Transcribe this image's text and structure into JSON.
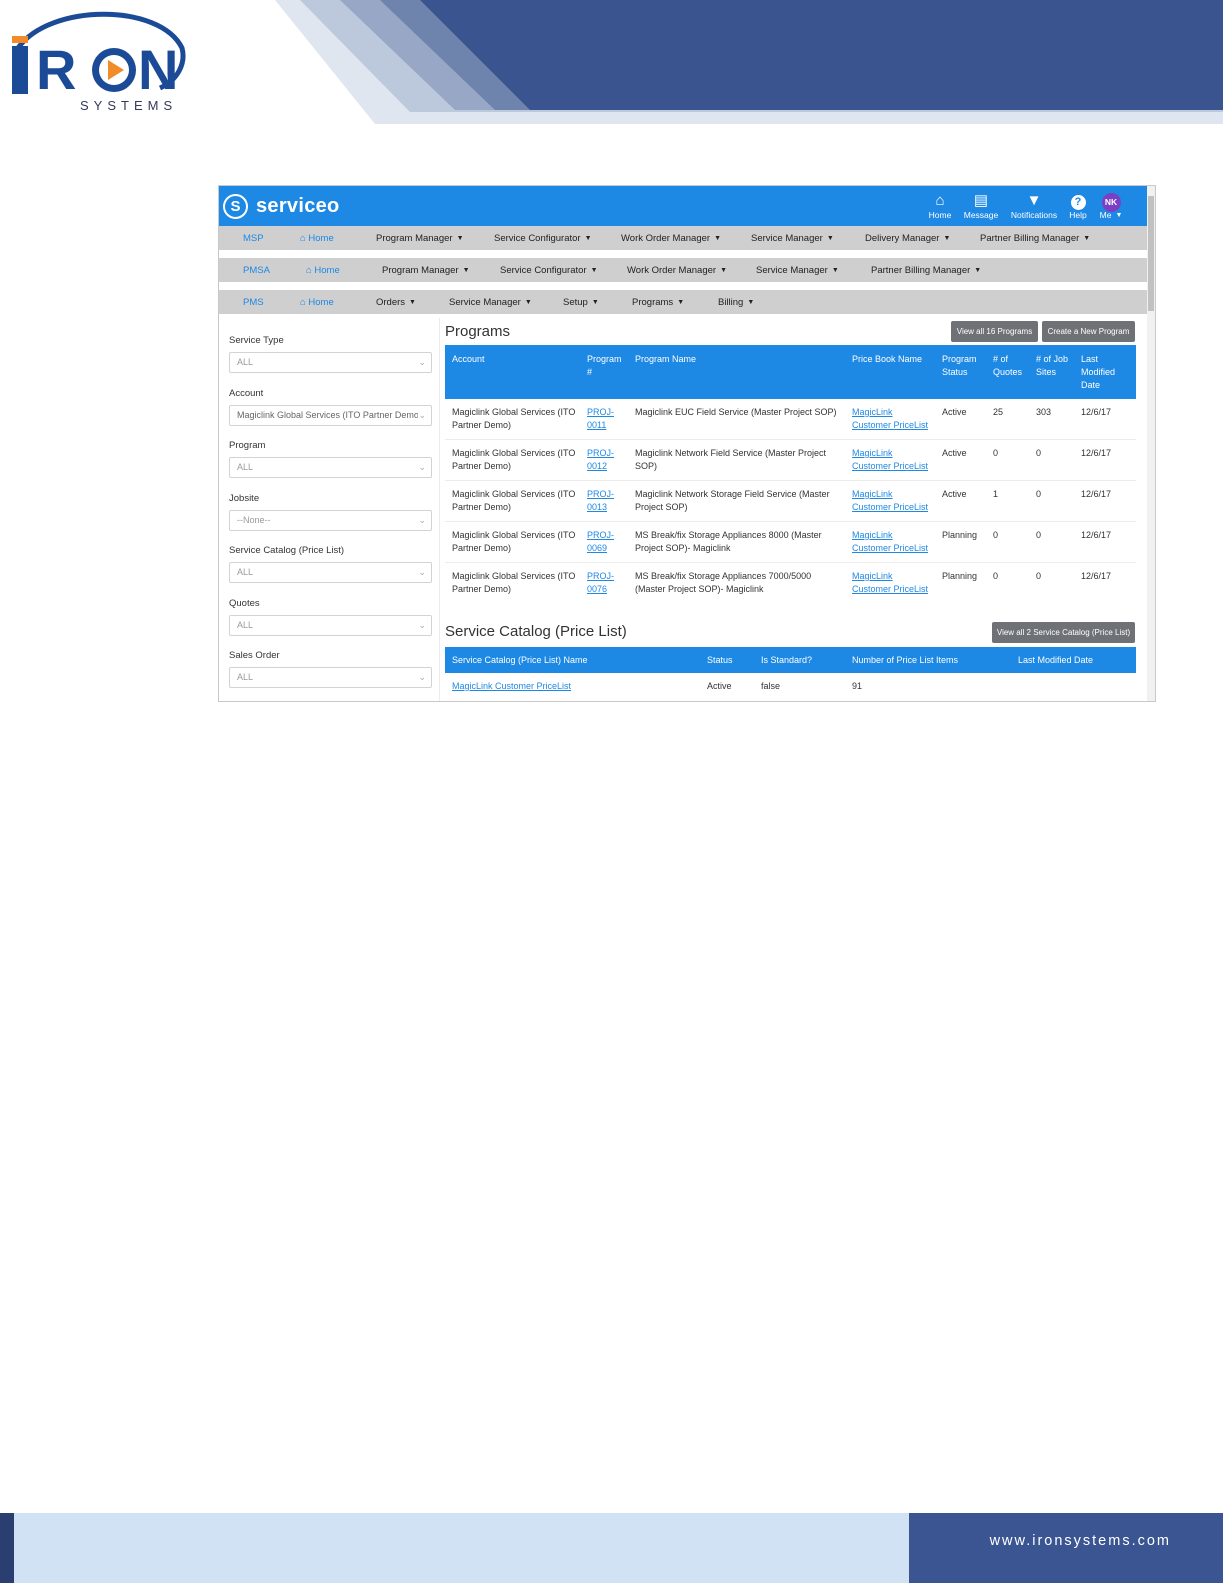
{
  "brand": {
    "logo_word": "IRON",
    "logo_sub": "SYSTEMS",
    "colors": {
      "banner_dark": "#39548f",
      "accent_blue": "#1b4a97",
      "play_orange": "#f28c28"
    }
  },
  "app": {
    "name": "serviceo",
    "logo_letter": "S",
    "top_icons": [
      {
        "label": "Home",
        "icon": "home-icon",
        "glyph": "⌂"
      },
      {
        "label": "Message",
        "icon": "message-icon",
        "glyph": "▤"
      },
      {
        "label": "Notifications",
        "icon": "bell-icon",
        "glyph": "🔔"
      },
      {
        "label": "Help",
        "icon": "help-icon",
        "glyph": "?"
      },
      {
        "label": "Me",
        "icon": "avatar",
        "avatar_initials": "NK"
      }
    ],
    "menus": [
      {
        "tag": "MSP",
        "home": "Home",
        "items": [
          "Program Manager",
          "Service Configurator",
          "Work Order Manager",
          "Service Manager",
          "Delivery Manager",
          "Partner Billing Manager"
        ]
      },
      {
        "tag": "PMSA",
        "home": "Home",
        "items": [
          "Program Manager",
          "Service Configurator",
          "Work Order Manager",
          "Service Manager",
          "Partner Billing Manager"
        ]
      },
      {
        "tag": "PMS",
        "home": "Home",
        "items": [
          "Orders",
          "Service Manager",
          "Setup",
          "Programs",
          "Billing"
        ]
      }
    ],
    "filters": [
      {
        "label": "Service Type",
        "value": "ALL"
      },
      {
        "label": "Account",
        "value": "Magiclink Global Services (ITO Partner Demo)"
      },
      {
        "label": "Program",
        "value": "ALL"
      },
      {
        "label": "Jobsite",
        "value": "--None--"
      },
      {
        "label": "Service Catalog (Price List)",
        "value": "ALL"
      },
      {
        "label": "Quotes",
        "value": "ALL"
      },
      {
        "label": "Sales Order",
        "value": "ALL"
      }
    ],
    "programs": {
      "title": "Programs",
      "view_all_button": "View all 16 Programs",
      "create_button": "Create a New Program",
      "columns": [
        "Account",
        "Program #",
        "Program Name",
        "Price Book Name",
        "Program Status",
        "# of Quotes",
        "# of Job Sites",
        "Last Modified Date"
      ],
      "rows": [
        {
          "account": "Magiclink Global Services (ITO Partner Demo)",
          "number": "PROJ-0011",
          "name": "Magiclink EUC Field Service (Master Project SOP)",
          "price_book": "MagicLink Customer PriceList",
          "status": "Active",
          "quotes": "25",
          "job_sites": "303",
          "modified": "12/6/17"
        },
        {
          "account": "Magiclink Global Services (ITO Partner Demo)",
          "number": "PROJ-0012",
          "name": "Magiclink Network Field Service (Master Project SOP)",
          "price_book": "MagicLink Customer PriceList",
          "status": "Active",
          "quotes": "0",
          "job_sites": "0",
          "modified": "12/6/17"
        },
        {
          "account": "Magiclink Global Services (ITO Partner Demo)",
          "number": "PROJ-0013",
          "name": "Magiclink Network Storage Field Service (Master Project SOP)",
          "price_book": "MagicLink Customer PriceList",
          "status": "Active",
          "quotes": "1",
          "job_sites": "0",
          "modified": "12/6/17"
        },
        {
          "account": "Magiclink Global Services (ITO Partner Demo)",
          "number": "PROJ-0069",
          "name": "MS Break/fix Storage Appliances 8000 (Master Project SOP)- Magiclink",
          "price_book": "MagicLink Customer PriceList",
          "status": "Planning",
          "quotes": "0",
          "job_sites": "0",
          "modified": "12/6/17"
        },
        {
          "account": "Magiclink Global Services (ITO Partner Demo)",
          "number": "PROJ-0076",
          "name": "MS Break/fix Storage Appliances 7000/5000 (Master Project SOP)- Magiclink",
          "price_book": "MagicLink Customer PriceList",
          "status": "Planning",
          "quotes": "0",
          "job_sites": "0",
          "modified": "12/6/17"
        }
      ]
    },
    "catalog": {
      "title": "Service Catalog (Price List)",
      "view_all_button": "View all 2 Service Catalog (Price List)",
      "columns": [
        "Service Catalog (Price List) Name",
        "Status",
        "Is Standard?",
        "Number of Price List Items",
        "Last Modified Date"
      ],
      "rows": [
        {
          "name": "MagicLink Customer PriceList",
          "status": "Active",
          "is_standard": "false",
          "items": "91",
          "modified": ""
        }
      ]
    }
  },
  "footer": {
    "url": "www.ironsystems.com"
  }
}
